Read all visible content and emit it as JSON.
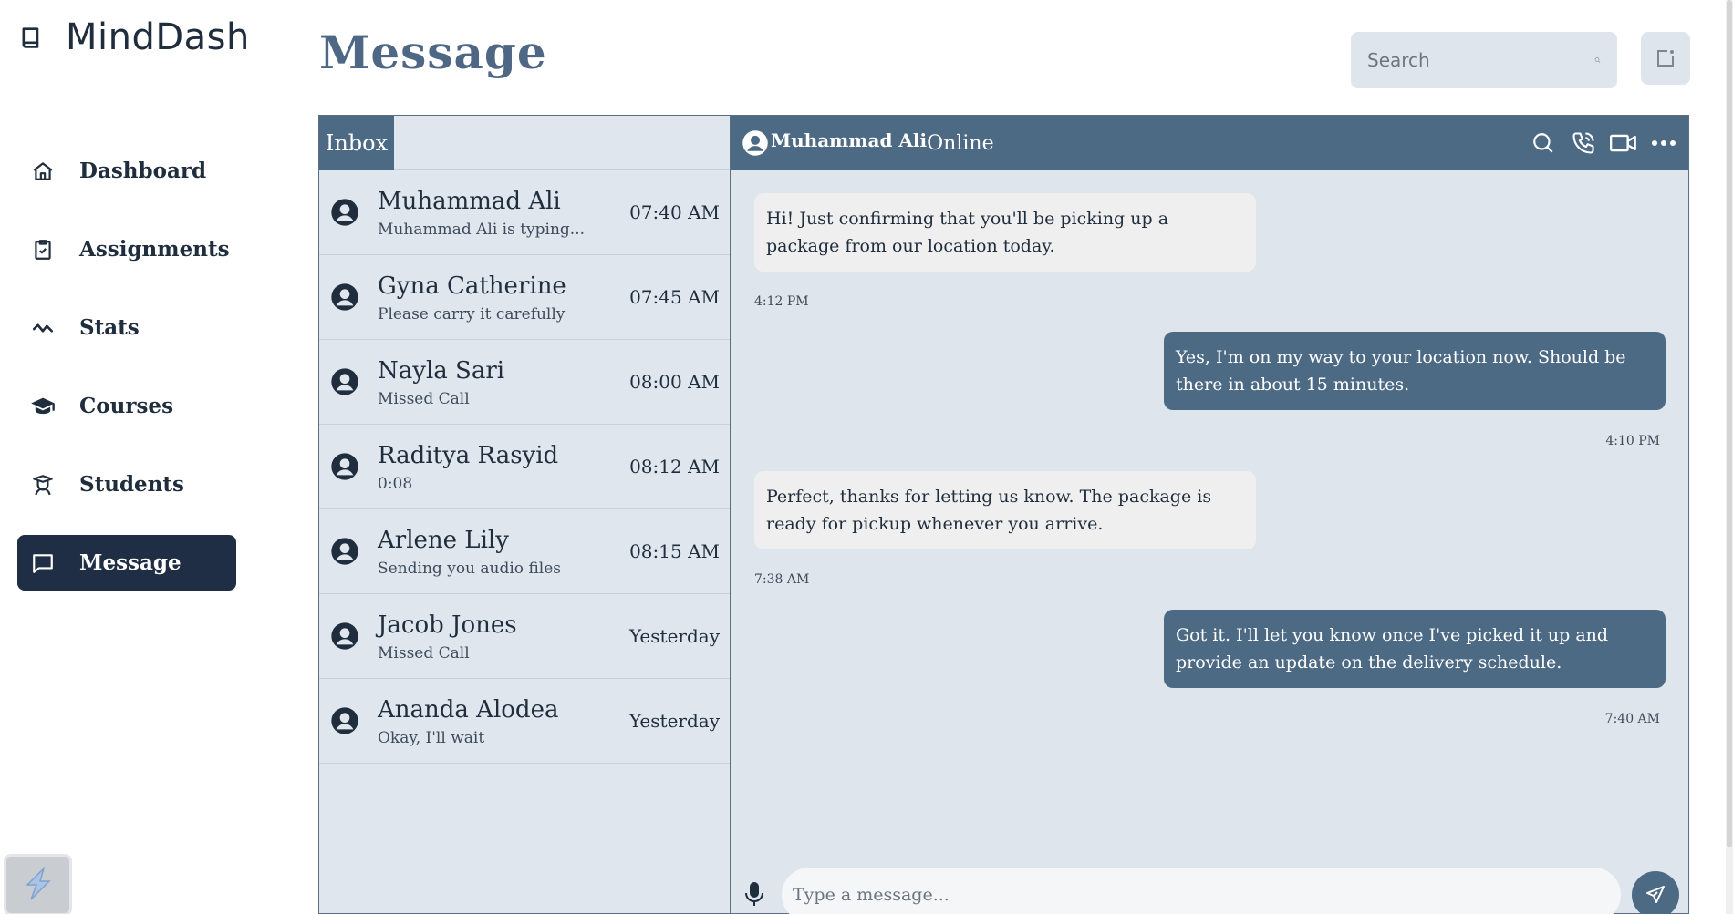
{
  "app": {
    "brand_name": "MindDash"
  },
  "sidebar": {
    "items": [
      {
        "label": "Dashboard",
        "icon": "home-icon",
        "active": false
      },
      {
        "label": "Assignments",
        "icon": "clipboard-check-icon",
        "active": false
      },
      {
        "label": "Stats",
        "icon": "trend-line-icon",
        "active": false
      },
      {
        "label": "Courses",
        "icon": "graduation-cap-icon",
        "active": false
      },
      {
        "label": "Students",
        "icon": "student-icon",
        "active": false
      },
      {
        "label": "Message",
        "icon": "chat-bubble-icon",
        "active": true
      }
    ]
  },
  "header": {
    "title": "Message",
    "search_placeholder": "Search"
  },
  "inbox": {
    "tab_label": "Inbox",
    "conversations": [
      {
        "name": "Muhammad Ali",
        "preview": "Muhammad Ali is typing...",
        "time": "07:40 AM"
      },
      {
        "name": "Gyna Catherine",
        "preview": "Please carry it carefully",
        "time": "07:45 AM"
      },
      {
        "name": "Nayla Sari",
        "preview": "Missed Call",
        "time": "08:00 AM"
      },
      {
        "name": "Raditya Rasyid",
        "preview": "0:08",
        "time": "08:12 AM"
      },
      {
        "name": "Arlene Lily",
        "preview": "Sending you audio files",
        "time": "08:15 AM"
      },
      {
        "name": "Jacob Jones",
        "preview": "Missed Call",
        "time": "Yesterday"
      },
      {
        "name": "Ananda Alodea",
        "preview": "Okay, I'll wait",
        "time": "Yesterday"
      }
    ]
  },
  "chat": {
    "contact_name": "Muhammad Ali",
    "status": "Online",
    "messages": [
      {
        "direction": "in",
        "text": "Hi! Just confirming that you'll be picking up a package from our location today.",
        "time": "4:12 PM"
      },
      {
        "direction": "out",
        "text": "Yes, I'm on my way to your location now. Should be there in about 15 minutes.",
        "time": "4:10 PM"
      },
      {
        "direction": "in",
        "text": "Perfect, thanks for letting us know. The package is ready for pickup whenever you arrive.",
        "time": "7:38 AM"
      },
      {
        "direction": "out",
        "text": "Got it. I'll let you know once I've picked it up and provide an update on the delivery schedule.",
        "time": "7:40 AM"
      }
    ],
    "input_placeholder": "Type a message..."
  },
  "colors": {
    "accent": "#4d6a85",
    "active_nav": "#1f2e45",
    "title": "#4d6784",
    "panel_bg": "#dee5ec",
    "incoming_bubble": "#efefef"
  }
}
